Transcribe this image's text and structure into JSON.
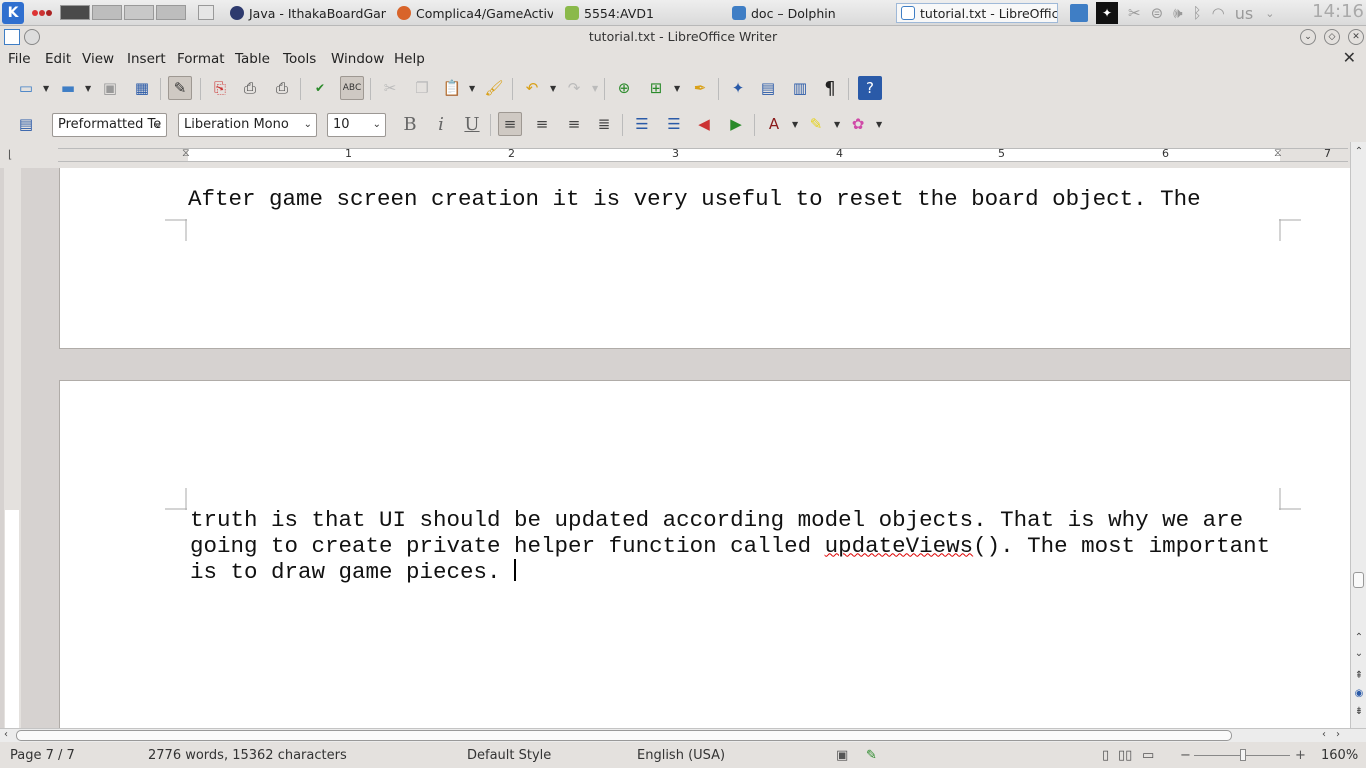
{
  "taskbar": {
    "tasks": [
      {
        "label": "Java - IthakaBoardGam",
        "icon": "eclipse-icon",
        "color": "#2e3a6e"
      },
      {
        "label": "Complica4/GameActivi",
        "icon": "firefox-icon",
        "color": "#d8642a"
      },
      {
        "label": "5554:AVD1",
        "icon": "android-icon",
        "color": "#8ab94a"
      },
      {
        "label": "doc – Dolphin",
        "icon": "folder-icon",
        "color": "#3f7ec5"
      },
      {
        "label": "tutorial.txt - LibreOffic",
        "icon": "writer-doc-icon",
        "color": "#3f7ec5"
      }
    ],
    "keyboard_layout": "us",
    "clock": "14:16"
  },
  "window": {
    "title": "tutorial.txt - LibreOffice Writer"
  },
  "menu": {
    "items": [
      "File",
      "Edit",
      "View",
      "Insert",
      "Format",
      "Table",
      "Tools",
      "Window",
      "Help"
    ]
  },
  "format_toolbar": {
    "paragraph_style": "Preformatted Te",
    "font_name": "Liberation Mono",
    "font_size": "10"
  },
  "ruler": {
    "numbers": [
      "1",
      "2",
      "3",
      "4",
      "5",
      "6",
      "7"
    ]
  },
  "document": {
    "page1_line": "After game screen creation it is very useful to reset the board object. The",
    "page2_lines": [
      "truth is that UI should be updated according model objects. That is why we are",
      "going to create private helper function called ",
      "is to draw game pieces. "
    ],
    "misspelled_word": "updateViews",
    "page2_line2_tail": "(). The most important"
  },
  "status": {
    "page": "Page 7 / 7",
    "word_count": "2776 words, 15362 characters",
    "page_style": "Default Style",
    "language": "English (USA)",
    "zoom": "160%"
  },
  "colors": {
    "chrome_bg": "#e4e1de",
    "doc_bg": "#d6d2d0",
    "misspell_underline": "#dd0000"
  }
}
